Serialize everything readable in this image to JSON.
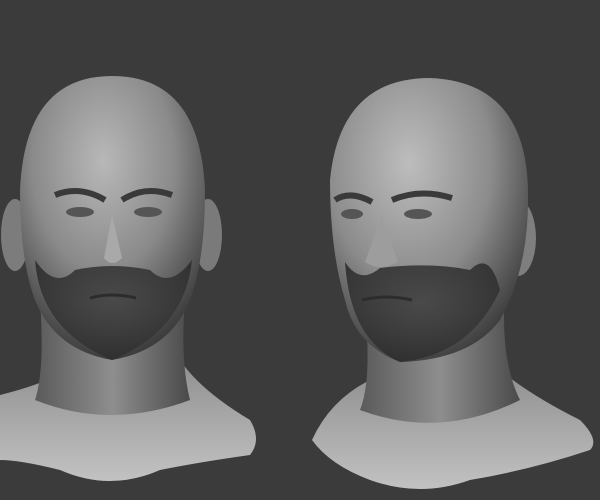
{
  "scene": {
    "background_color": "#3b3b3b",
    "material_color": "#9a9a9a",
    "shadow_color": "#1e1e1e",
    "figures": [
      {
        "view": "front"
      },
      {
        "view": "three-quarter"
      }
    ]
  }
}
